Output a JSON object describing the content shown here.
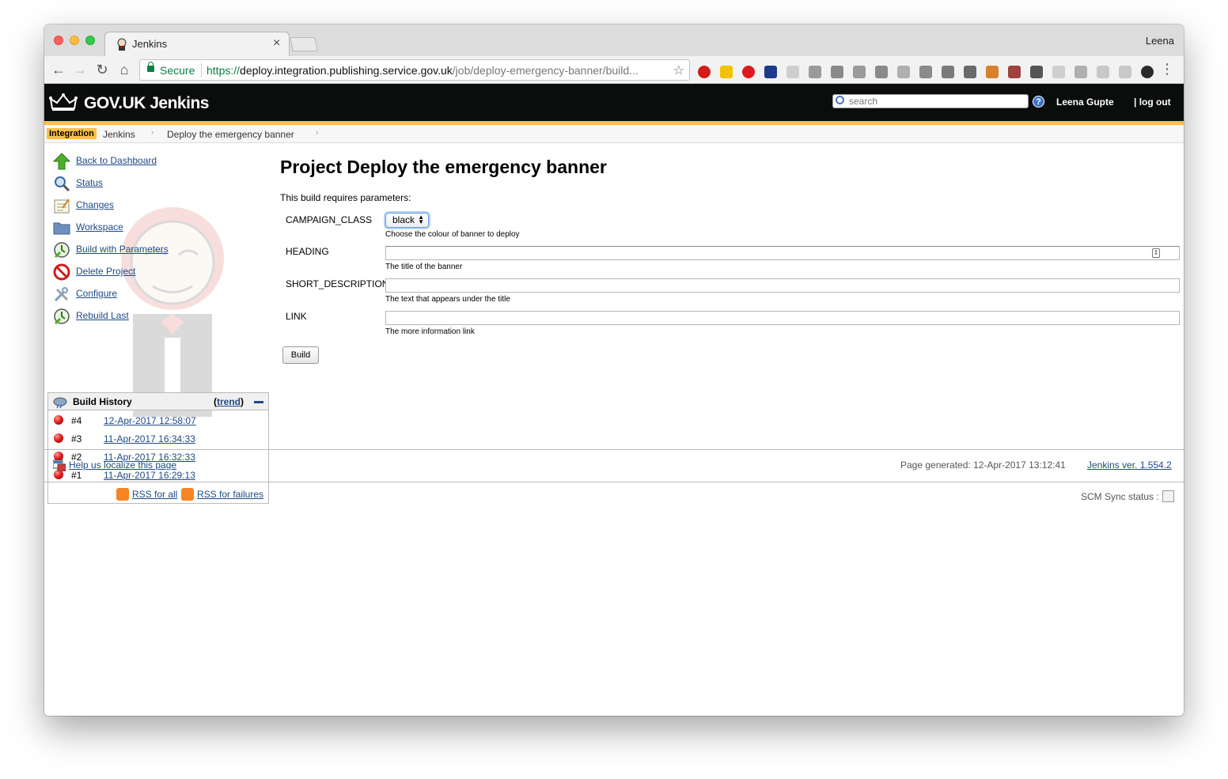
{
  "browser": {
    "tab_title": "Jenkins",
    "profile_name": "Leena",
    "secure_label": "Secure",
    "url_scheme": "https://",
    "url_host": "deploy.integration.publishing.service.gov.uk",
    "url_path": "/job/deploy-emergency-banner/build...",
    "extension_icons": [
      "adblock-plus-icon",
      "extension-icon",
      "opera-icon",
      "notes-icon",
      "extension-icon",
      "extension-icon",
      "grid-icon",
      "c-icon",
      "cast-icon",
      "extension-icon",
      "trello-icon",
      "hash-icon",
      "piano-icon",
      "color-wheel-icon",
      "avatar-icon",
      "crown-icon",
      "extension-icon",
      "tc-icon",
      "extension-icon",
      "extension-icon",
      "chrome-icon"
    ]
  },
  "header": {
    "logo_text": "GOV.UK Jenkins",
    "search_placeholder": "search",
    "user_name": "Leena Gupte",
    "logout_label": "| log out"
  },
  "breadcrumbs": {
    "environment": "Integration",
    "items": [
      "Jenkins",
      "Deploy the emergency banner"
    ]
  },
  "sidebar": {
    "tasks": [
      {
        "label": "Back to Dashboard",
        "icon": "up-arrow-icon"
      },
      {
        "label": "Status",
        "icon": "magnifier-icon"
      },
      {
        "label": "Changes",
        "icon": "notepad-icon"
      },
      {
        "label": "Workspace",
        "icon": "folder-icon"
      },
      {
        "label": "Build with Parameters",
        "icon": "clock-icon"
      },
      {
        "label": "Delete Project",
        "icon": "no-entry-icon"
      },
      {
        "label": "Configure",
        "icon": "tools-icon"
      },
      {
        "label": "Rebuild Last",
        "icon": "clock-icon"
      }
    ],
    "build_history": {
      "title": "Build History",
      "trend_open": "(",
      "trend_label": "trend",
      "trend_close": ")",
      "builds": [
        {
          "number": "#4",
          "date": "12-Apr-2017 12:58:07",
          "status": "failed"
        },
        {
          "number": "#3",
          "date": "11-Apr-2017 16:34:33",
          "status": "failed"
        },
        {
          "number": "#2",
          "date": "11-Apr-2017 16:32:33",
          "status": "failed"
        },
        {
          "number": "#1",
          "date": "11-Apr-2017 16:29:13",
          "status": "failed"
        }
      ],
      "rss_all": "RSS for all",
      "rss_failures": "RSS for failures"
    }
  },
  "main": {
    "title": "Project Deploy the emergency banner",
    "intro": "This build requires parameters:",
    "params": [
      {
        "name": "CAMPAIGN_CLASS",
        "type": "select",
        "value": "black",
        "description": "Choose the colour of banner to deploy"
      },
      {
        "name": "HEADING",
        "type": "text",
        "value": "",
        "description": "The title of the banner"
      },
      {
        "name": "SHORT_DESCRIPTION",
        "type": "text",
        "value": "",
        "description": "The text that appears under the title"
      },
      {
        "name": "LINK",
        "type": "text",
        "value": "",
        "description": "The more information link"
      }
    ],
    "build_button": "Build"
  },
  "footer": {
    "localize_link": "Help us localize this page",
    "generated": "Page generated: 12-Apr-2017 13:12:41",
    "version_link": "Jenkins ver. 1.554.2",
    "scm_status": "SCM Sync status :"
  },
  "colors": {
    "header_bg": "#0b0c0c",
    "accent_yellow": "#ffbf47",
    "link_blue": "#204a87",
    "failed_red": "#e02020",
    "secure_green": "#0b8043"
  }
}
